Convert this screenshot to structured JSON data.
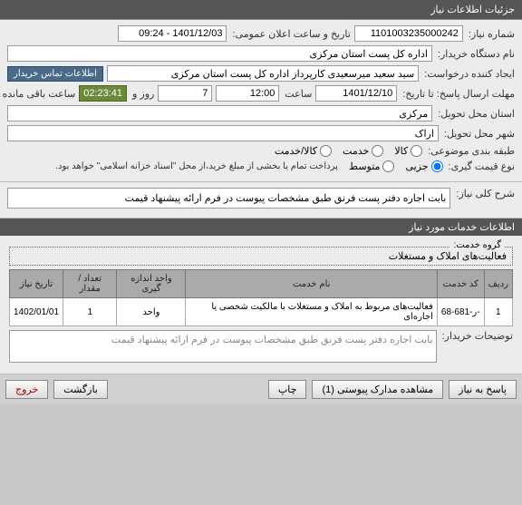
{
  "header": {
    "title": "جزئیات اطلاعات نیاز"
  },
  "form": {
    "req_no_label": "شماره نیاز:",
    "req_no": "1101003235000242",
    "announce_label": "تاریخ و ساعت اعلان عمومی:",
    "announce_time": "1401/12/03 - 09:24",
    "buyer_label": "نام دستگاه خریدار:",
    "buyer": "اداره کل پست استان مرکزی",
    "creator_label": "ایجاد کننده درخواست:",
    "creator": "سید سعید میرسعیدی کارپرداز اداره کل پست استان مرکزی",
    "contact_btn": "اطلاعات تماس خریدار",
    "deadline_label": "مهلت ارسال پاسخ: تا تاریخ:",
    "deadline_date": "1401/12/10",
    "time_word": "ساعت",
    "deadline_time": "12:00",
    "days": "7",
    "day_and": "روز و",
    "remain": "02:23:41",
    "remain_suffix": "ساعت باقی مانده",
    "province_label": "استان محل تحویل:",
    "province": "مرکزی",
    "city_label": "شهر محل تحویل:",
    "city": "اراک",
    "class_label": "طبقه بندی موضوعی:",
    "opt_goods": "کالا",
    "opt_service": "خدمت",
    "opt_both": "کالا/خدمت",
    "price_type_label": "نوع قیمت گیری:",
    "opt_partial": "جزیی",
    "opt_medium": "متوسط",
    "price_note": "پرداخت تمام یا بخشی از مبلغ خرید،از محل \"اسناد خزانه اسلامی\" خواهد بود."
  },
  "sections": {
    "general_desc_label": "شرح کلی نیاز:",
    "general_desc": "بابت اجاره دفتر پست فرنق طبق مشخصات پیوست در فرم ارائه پیشنهاد قیمت",
    "services_title": "اطلاعات خدمات مورد نیاز",
    "group_label": "گروه خدمت:",
    "group_text": "فعالیت‌های  املاک و مستغلات",
    "buyer_notes_label": "توضیحات خریدار:",
    "buyer_notes": "بابت اجاره دفتر پست فرنق طبق مشخصات پیوست در فرم ارائه پیشنهاد قیمت"
  },
  "table": {
    "headers": {
      "row": "ردیف",
      "code": "کد خدمت",
      "name": "نام خدمت",
      "unit": "واحد اندازه گیری",
      "qty": "تعداد / مقدار",
      "date": "تاریخ نیاز"
    },
    "rows": [
      {
        "row": "1",
        "code": "-ر-681-68",
        "name": "فعالیت‌های مربوط به املاک و مستغلات با مالکیت شخصی یا اجاره‌ای",
        "unit": "واحد",
        "qty": "1",
        "date": "1402/01/01"
      }
    ]
  },
  "footer": {
    "reply": "پاسخ به نیاز",
    "attach": "مشاهده مدارک پیوستی (1)",
    "print": "چاپ",
    "back": "بازگشت",
    "exit": "خروج"
  }
}
